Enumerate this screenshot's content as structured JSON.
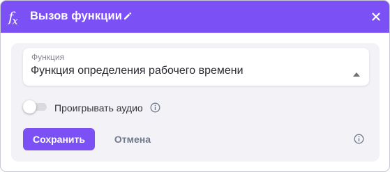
{
  "dialog": {
    "title": "Вызов функции",
    "icon": "function-fx-icon",
    "accent_color": "#7b51f5"
  },
  "field": {
    "label": "Функция",
    "value": "Функция определения рабочего времени"
  },
  "toggle": {
    "label": "Проигрывать аудио",
    "enabled": false
  },
  "actions": {
    "save_label": "Сохранить",
    "cancel_label": "Отмена"
  }
}
